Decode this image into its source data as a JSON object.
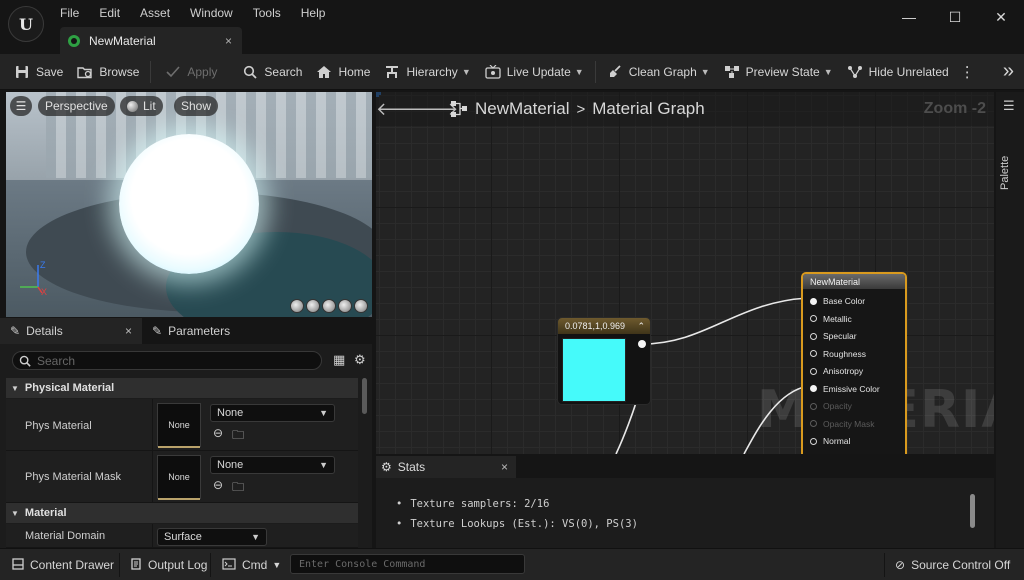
{
  "app": {
    "logo_letter": "U"
  },
  "menu": [
    "File",
    "Edit",
    "Asset",
    "Window",
    "Tools",
    "Help"
  ],
  "window_controls": {
    "minimize": "—",
    "maximize": "☐",
    "close": "✕"
  },
  "document_tab": {
    "label": "NewMaterial",
    "close": "×"
  },
  "toolbar": {
    "save": "Save",
    "browse": "Browse",
    "apply": "Apply",
    "search": "Search",
    "home": "Home",
    "hierarchy": "Hierarchy",
    "live_update": "Live Update",
    "clean_graph": "Clean Graph",
    "preview_state": "Preview State",
    "hide_unrelated": "Hide Unrelated",
    "more": "⋮",
    "expand": "»"
  },
  "viewport": {
    "menu": "☰",
    "perspective": "Perspective",
    "lit": "Lit",
    "show": "Show",
    "axis_z": "Z",
    "axis_x": "X"
  },
  "details": {
    "tab_details": "Details",
    "tab_parameters": "Parameters",
    "tab_close": "×",
    "search_placeholder": "Search",
    "cat_physical": "Physical Material",
    "phys_material": {
      "label": "Phys Material",
      "thumb": "None",
      "value": "None"
    },
    "phys_material_mask": {
      "label": "Phys Material Mask",
      "thumb": "None",
      "value": "None"
    },
    "cat_material": "Material",
    "material_domain": {
      "label": "Material Domain",
      "value": "Surface"
    }
  },
  "graph": {
    "crumb_asset": "NewMaterial",
    "crumb_sep": ">",
    "crumb_graph": "Material Graph",
    "zoom": "Zoom -2",
    "watermark": "MATERIAL",
    "constant_node": {
      "title": "0.0781,1,0.969",
      "color": "#45fafa"
    },
    "material_node": {
      "title": "NewMaterial",
      "pins": [
        {
          "label": "Base Color",
          "connected": true,
          "enabled": true
        },
        {
          "label": "Metallic",
          "connected": false,
          "enabled": true
        },
        {
          "label": "Specular",
          "connected": false,
          "enabled": true
        },
        {
          "label": "Roughness",
          "connected": false,
          "enabled": true
        },
        {
          "label": "Anisotropy",
          "connected": false,
          "enabled": true
        },
        {
          "label": "Emissive Color",
          "connected": true,
          "enabled": true
        },
        {
          "label": "Opacity",
          "connected": false,
          "enabled": false
        },
        {
          "label": "Opacity Mask",
          "connected": false,
          "enabled": false
        },
        {
          "label": "Normal",
          "connected": false,
          "enabled": true
        }
      ]
    }
  },
  "palette": {
    "label": "Palette"
  },
  "stats": {
    "tab": "Stats",
    "close": "×",
    "lines": [
      "Texture samplers: 2/16",
      "Texture Lookups (Est.): VS(0), PS(3)"
    ]
  },
  "bottom": {
    "content_drawer": "Content Drawer",
    "output_log": "Output Log",
    "cmd": "Cmd",
    "console_placeholder": "Enter Console Command",
    "source_control": "Source Control Off"
  },
  "colors": {
    "accent_node_border": "#d99a1e",
    "constant_color": "#45fafa",
    "tab_icon": "#2ea043"
  }
}
